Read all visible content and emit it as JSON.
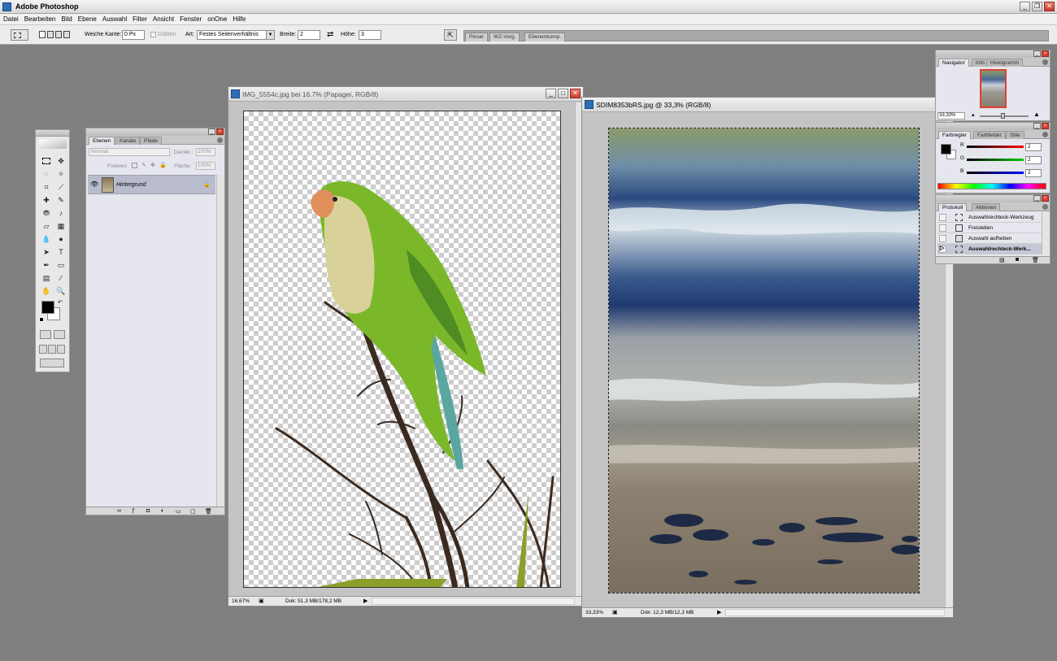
{
  "app": {
    "title": "Adobe Photoshop"
  },
  "menu": [
    "Datei",
    "Bearbeiten",
    "Bild",
    "Ebene",
    "Auswahl",
    "Filter",
    "Ansicht",
    "Fenster",
    "onOne",
    "Hilfe"
  ],
  "options": {
    "feather_label": "Weiche Kante:",
    "feather_value": "0 Px",
    "smooth_label": "Glätten",
    "style_label": "Art:",
    "style_value": "Festes Seitenverhältnis",
    "width_label": "Breite:",
    "width_value": "2",
    "height_label": "Höhe:",
    "height_value": "3"
  },
  "palette_well_tabs": [
    "Pinsel",
    "WZ-Vorg.",
    "Ebenenkomp."
  ],
  "layers_panel": {
    "tabs": [
      "Ebenen",
      "Kanäle",
      "Pfade"
    ],
    "blend_mode": "Normal",
    "opacity_label": "Deckkr.:",
    "opacity_value": "100%",
    "lock_label": "Fixieren:",
    "fill_label": "Fläche:",
    "fill_value": "100%",
    "layer_name": "Hintergrund"
  },
  "doc1": {
    "title": "IMG_5554c.jpg bei 16.7% (Papagei, RGB/8)",
    "zoom": "16,67%",
    "doc_size": "Dok: 51,3 MB/178,2 MB"
  },
  "doc2": {
    "title": "SDIM8353bRS.jpg @ 33,3% (RGB/8)",
    "zoom": "33,33%",
    "doc_size": "Dok: 12,3 MB/12,3 MB"
  },
  "navigator": {
    "tabs": [
      "Navigator",
      "Info",
      "Histogramm"
    ],
    "zoom": "33,33%"
  },
  "color_panel": {
    "tabs": [
      "Farbregler",
      "Farbfelder",
      "Stile"
    ],
    "r_label": "R",
    "r_value": "2",
    "g_label": "G",
    "g_value": "2",
    "b_label": "B",
    "b_value": "2"
  },
  "history_panel": {
    "tabs": [
      "Protokoll",
      "Aktionen"
    ],
    "items": [
      "Auswahlrechteck-Werkzeug",
      "Freistellen",
      "Auswahl aufheben",
      "Auswahlrechteck-Werk..."
    ]
  },
  "colors": {
    "foreground": "#000000",
    "background": "#ffffff"
  }
}
